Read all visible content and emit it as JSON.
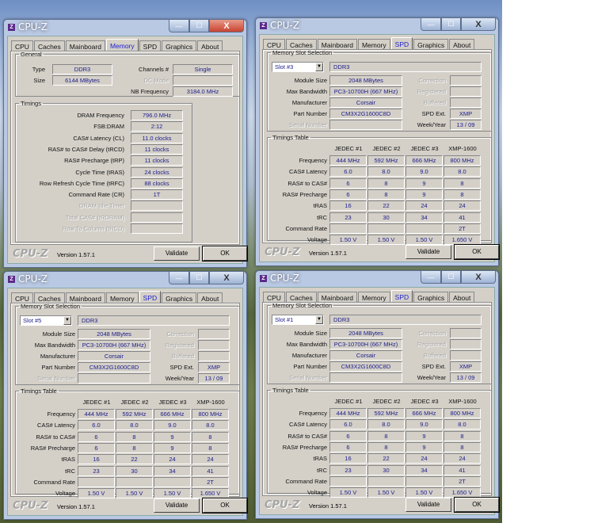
{
  "app": {
    "title": "CPU-Z",
    "icon_letter": "Z",
    "brand": "CPU-Z",
    "version": "Version 1.57.1",
    "validate_label": "Validate",
    "ok_label": "OK",
    "tabs": [
      "CPU",
      "Caches",
      "Mainboard",
      "Memory",
      "SPD",
      "Graphics",
      "About"
    ],
    "window_controls": {
      "minimize": "—",
      "maximize": "☐",
      "close": "X"
    }
  },
  "memory_window": {
    "active_tab": "Memory",
    "general": {
      "legend": "General",
      "type_label": "Type",
      "type": "DDR3",
      "size_label": "Size",
      "size": "6144 MBytes",
      "channels_label": "Channels #",
      "channels": "Single",
      "dc_mode_label": "DC Mode",
      "dc_mode": "",
      "nb_freq_label": "NB Frequency",
      "nb_freq": "3184.0 MHz"
    },
    "timings": {
      "legend": "Timings",
      "rows": [
        {
          "label": "DRAM Frequency",
          "value": "796.0 MHz",
          "dim": false
        },
        {
          "label": "FSB:DRAM",
          "value": "2:12",
          "dim": false
        },
        {
          "label": "CAS# Latency (CL)",
          "value": "11.0 clocks",
          "dim": false
        },
        {
          "label": "RAS# to CAS# Delay (tRCD)",
          "value": "11 clocks",
          "dim": false
        },
        {
          "label": "RAS# Precharge (tRP)",
          "value": "11 clocks",
          "dim": false
        },
        {
          "label": "Cycle Time (tRAS)",
          "value": "24 clocks",
          "dim": false
        },
        {
          "label": "Row Refresh Cycle Time (tRFC)",
          "value": "88 clocks",
          "dim": false
        },
        {
          "label": "Command Rate (CR)",
          "value": "1T",
          "dim": false
        },
        {
          "label": "DRAM Idle Timer",
          "value": "",
          "dim": true
        },
        {
          "label": "Total CAS# (tRDRAM)",
          "value": "",
          "dim": true
        },
        {
          "label": "Row To Column (tRCD)",
          "value": "",
          "dim": true
        }
      ]
    }
  },
  "spd_labels": {
    "slot_legend": "Memory Slot Selection",
    "module_size": "Module Size",
    "max_bandwidth": "Max Bandwidth",
    "manufacturer": "Manufacturer",
    "part_number": "Part Number",
    "serial_number": "Serial Number",
    "correction": "Correction",
    "registered": "Registered",
    "buffered": "Buffered",
    "spd_ext": "SPD Ext.",
    "week_year": "Week/Year",
    "timings_legend": "Timings Table",
    "columns": [
      "JEDEC #1",
      "JEDEC #2",
      "JEDEC #3",
      "XMP-1600"
    ],
    "row_labels": [
      "Frequency",
      "CAS# Latency",
      "RAS# to CAS#",
      "RAS# Precharge",
      "tRAS",
      "tRC",
      "Command Rate",
      "Voltage"
    ]
  },
  "spd_windows": [
    {
      "active_tab": "SPD",
      "slot": "Slot #3",
      "type": "DDR3",
      "module_size": "2048 MBytes",
      "max_bandwidth": "PC3-10700H (667 MHz)",
      "manufacturer": "Corsair",
      "part_number": "CM3X2G1600C8D",
      "serial_number": "",
      "correction": "",
      "registered": "",
      "buffered": "",
      "spd_ext": "XMP",
      "week_year": "13 / 09",
      "timings": [
        [
          "444 MHz",
          "592 MHz",
          "666 MHz",
          "800 MHz"
        ],
        [
          "6.0",
          "8.0",
          "9.0",
          "8.0"
        ],
        [
          "6",
          "8",
          "9",
          "8"
        ],
        [
          "6",
          "8",
          "9",
          "8"
        ],
        [
          "16",
          "22",
          "24",
          "24"
        ],
        [
          "23",
          "30",
          "34",
          "41"
        ],
        [
          "",
          "",
          "",
          "2T"
        ],
        [
          "1.50 V",
          "1.50 V",
          "1.50 V",
          "1.650 V"
        ]
      ]
    },
    {
      "active_tab": "SPD",
      "slot": "Slot #5",
      "type": "DDR3",
      "module_size": "2048 MBytes",
      "max_bandwidth": "PC3-10700H (667 MHz)",
      "manufacturer": "Corsair",
      "part_number": "CM3X2G1600C8D",
      "serial_number": "",
      "correction": "",
      "registered": "",
      "buffered": "",
      "spd_ext": "XMP",
      "week_year": "13 / 09",
      "timings": [
        [
          "444 MHz",
          "592 MHz",
          "666 MHz",
          "800 MHz"
        ],
        [
          "6.0",
          "8.0",
          "9.0",
          "8.0"
        ],
        [
          "6",
          "8",
          "9",
          "8"
        ],
        [
          "6",
          "8",
          "9",
          "8"
        ],
        [
          "16",
          "22",
          "24",
          "24"
        ],
        [
          "23",
          "30",
          "34",
          "41"
        ],
        [
          "",
          "",
          "",
          "2T"
        ],
        [
          "1.50 V",
          "1.50 V",
          "1.50 V",
          "1.650 V"
        ]
      ]
    },
    {
      "active_tab": "SPD",
      "slot": "Slot #1",
      "type": "DDR3",
      "module_size": "2048 MBytes",
      "max_bandwidth": "PC3-10700H (667 MHz)",
      "manufacturer": "Corsair",
      "part_number": "CM3X2G1600C8D",
      "serial_number": "",
      "correction": "",
      "registered": "",
      "buffered": "",
      "spd_ext": "XMP",
      "week_year": "13 / 09",
      "timings": [
        [
          "444 MHz",
          "592 MHz",
          "666 MHz",
          "800 MHz"
        ],
        [
          "6.0",
          "8.0",
          "9.0",
          "8.0"
        ],
        [
          "6",
          "8",
          "9",
          "8"
        ],
        [
          "6",
          "8",
          "9",
          "8"
        ],
        [
          "16",
          "22",
          "24",
          "24"
        ],
        [
          "23",
          "30",
          "34",
          "41"
        ],
        [
          "",
          "",
          "",
          "2T"
        ],
        [
          "1.50 V",
          "1.50 V",
          "1.50 V",
          "1.650 V"
        ]
      ]
    }
  ]
}
